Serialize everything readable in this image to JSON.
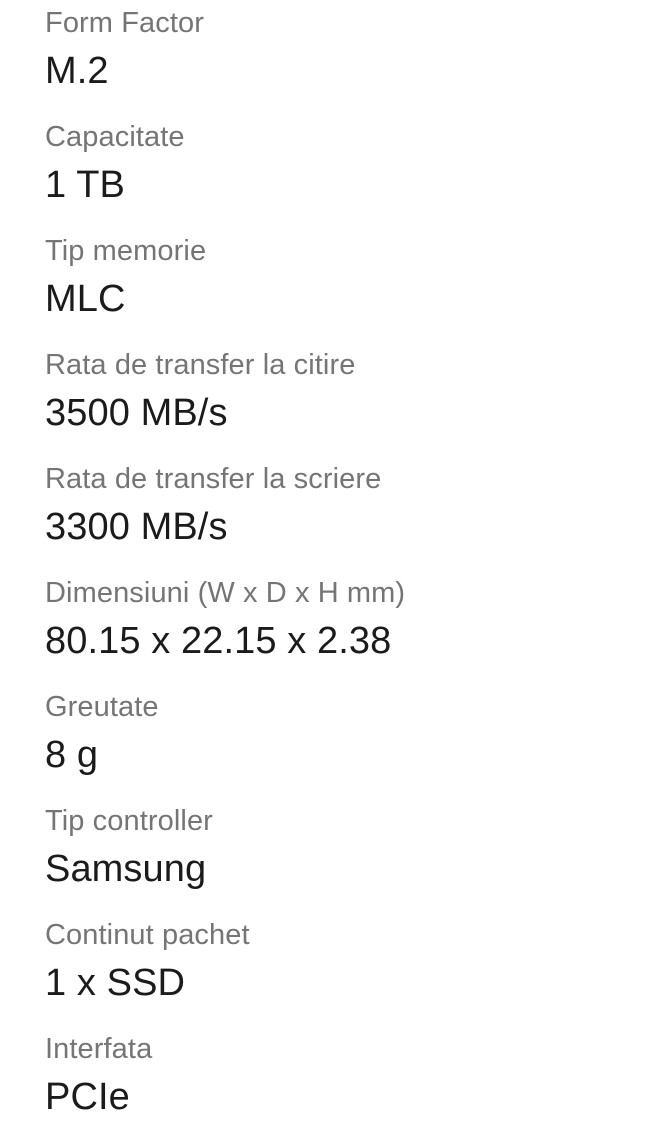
{
  "screen": {
    "background_color": "#ffffff",
    "label_color": "#757575",
    "value_color": "#1b1b1b"
  },
  "specs": {
    "rows": [
      {
        "label": "Form Factor",
        "value": "M.2"
      },
      {
        "label": "Capacitate",
        "value": "1 TB"
      },
      {
        "label": "Tip memorie",
        "value": "MLC"
      },
      {
        "label": "Rata de transfer la citire",
        "value": "3500 MB/s"
      },
      {
        "label": "Rata de transfer la scriere",
        "value": "3300 MB/s"
      },
      {
        "label": "Dimensiuni (W x D x H mm)",
        "value": "80.15 x 22.15 x 2.38"
      },
      {
        "label": "Greutate",
        "value": "8 g"
      },
      {
        "label": "Tip controller",
        "value": "Samsung"
      },
      {
        "label": "Continut pachet",
        "value": "1 x SSD"
      },
      {
        "label": "Interfata",
        "value": "PCIe"
      }
    ]
  }
}
